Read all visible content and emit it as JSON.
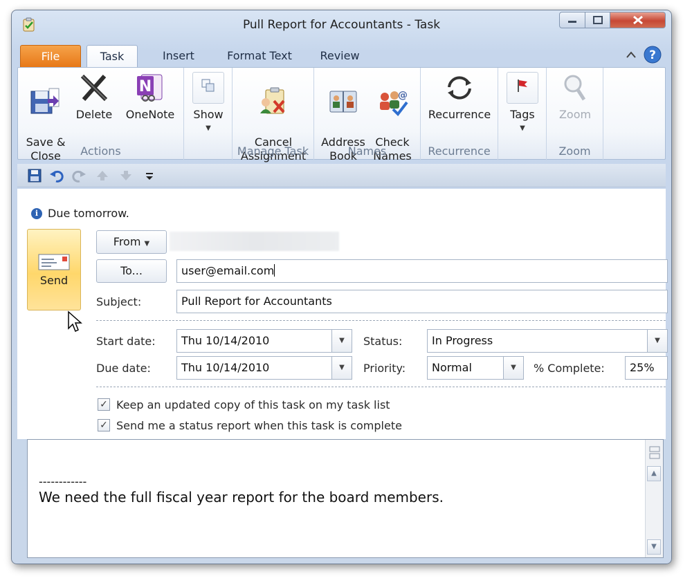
{
  "window": {
    "title": "Pull Report for Accountants  -  Task"
  },
  "ribbon_tabs": [
    {
      "label": "File"
    },
    {
      "label": "Task"
    },
    {
      "label": "Insert"
    },
    {
      "label": "Format Text"
    },
    {
      "label": "Review"
    }
  ],
  "groups": {
    "actions": {
      "label": "Actions",
      "save_close": "Save &\nClose",
      "delete": "Delete",
      "onenote": "OneNote"
    },
    "show": {
      "label": "Show"
    },
    "manage_task": {
      "label": "Manage Task",
      "cancel_assignment": "Cancel\nAssignment"
    },
    "names": {
      "label": "Names",
      "address_book": "Address\nBook",
      "check_names": "Check\nNames"
    },
    "recurrence": {
      "label": "Recurrence",
      "button": "Recurrence"
    },
    "tags": {
      "label": "Tags"
    },
    "zoom": {
      "label": "Zoom",
      "button": "Zoom"
    }
  },
  "info": {
    "message": "Due tomorrow."
  },
  "form": {
    "send": "Send",
    "from": "From",
    "to": "To...",
    "to_value": "user@email.com",
    "subject_label": "Subject:",
    "subject_value": "Pull Report for Accountants",
    "start_label": "Start date:",
    "start_value": "Thu 10/14/2010",
    "due_label": "Due date:",
    "due_value": "Thu 10/14/2010",
    "status_label": "Status:",
    "status_value": "In Progress",
    "priority_label": "Priority:",
    "priority_value": "Normal",
    "complete_label": "% Complete:",
    "complete_value": "25%",
    "keep_copy": "Keep an updated copy of this task on my task list",
    "status_report": "Send me a status report when this task is complete"
  },
  "body": {
    "separator": "------------",
    "text": "We need the full fiscal year report for the board members."
  },
  "colors": {
    "file_tab": "#e77817",
    "send_button": "#ffd76b",
    "close_button": "#c74835"
  }
}
